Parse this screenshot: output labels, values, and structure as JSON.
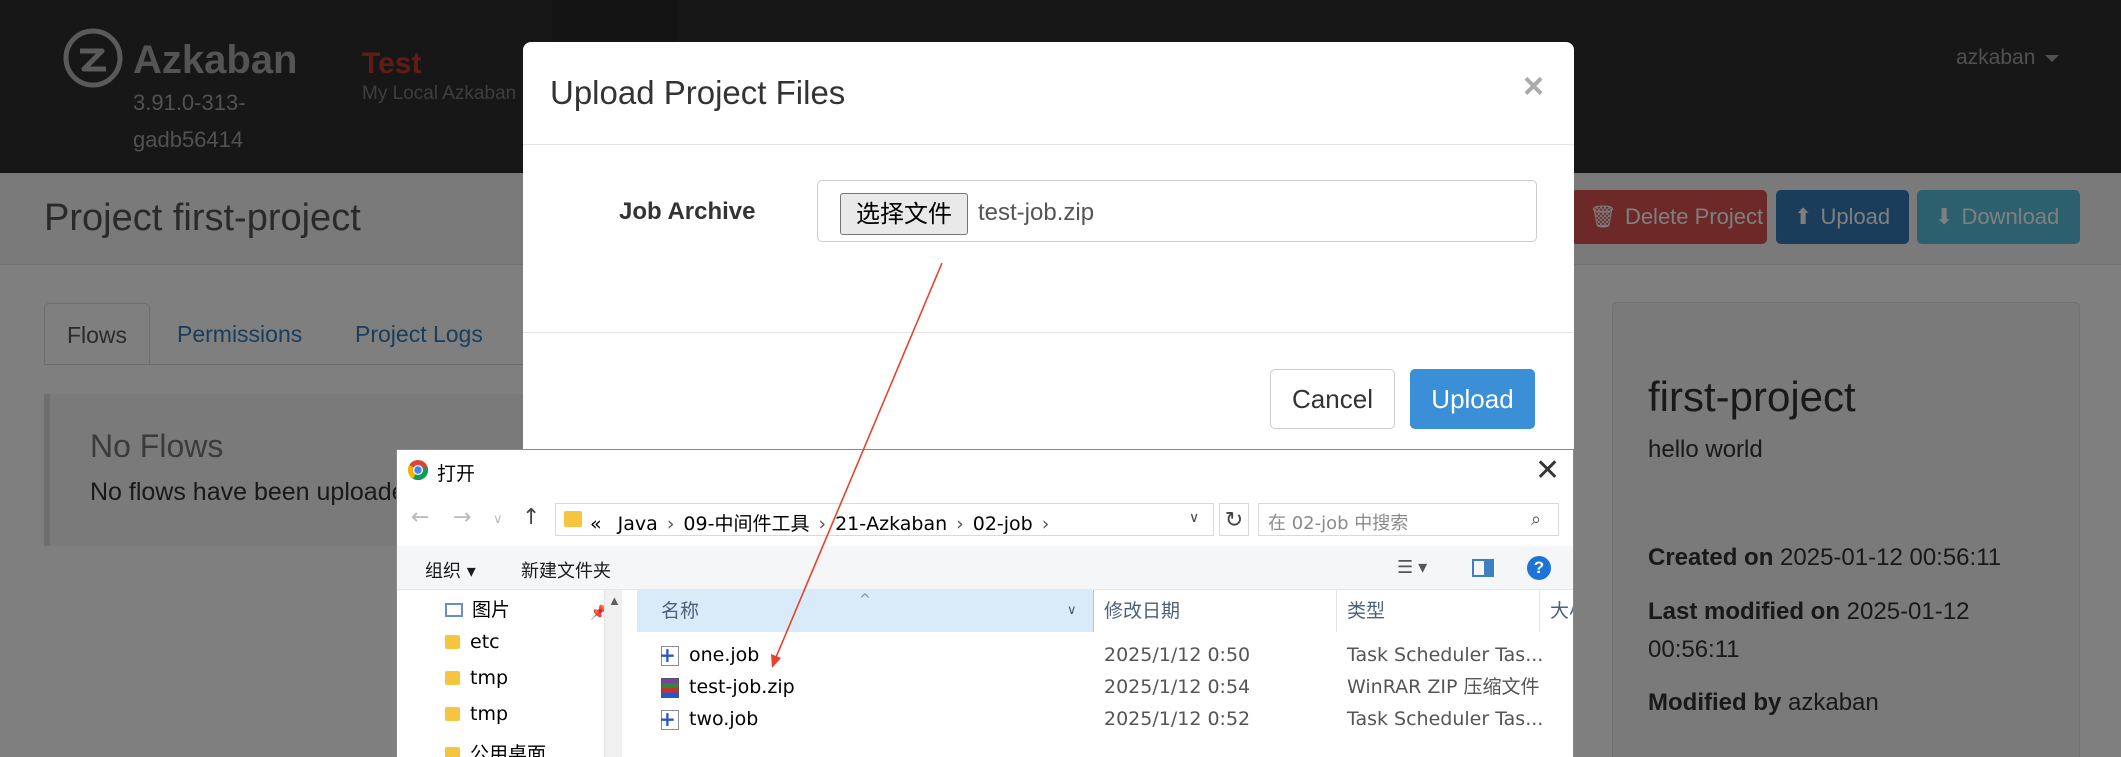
{
  "app": {
    "brand": "Azkaban",
    "version": "3.91.0-313-gadb56414",
    "env_name": "Test",
    "env_subtitle": "My Local Azkaban",
    "user": "azkaban"
  },
  "project": {
    "title": "Project first-project",
    "actions": {
      "delete_label": "Delete Project",
      "upload_label": "Upload",
      "download_label": "Download"
    },
    "tabs": [
      {
        "label": "Flows",
        "active": true
      },
      {
        "label": "Permissions",
        "active": false
      },
      {
        "label": "Project Logs",
        "active": false
      }
    ],
    "no_flows": {
      "title": "No Flows",
      "text": "No flows have been uploaded"
    },
    "info": {
      "name": "first-project",
      "description": "hello world",
      "created_label": "Created on",
      "created_value": "2025-01-12 00:56:11",
      "modified_label": "Last modified on",
      "modified_value": "2025-01-12 00:56:11",
      "modified_by_label": "Modified by",
      "modified_by_value": "azkaban"
    }
  },
  "modal": {
    "title": "Upload Project Files",
    "close_glyph": "×",
    "field_label": "Job Archive",
    "choose_file_label": "选择文件",
    "chosen_file": "test-job.zip",
    "cancel_label": "Cancel",
    "upload_label": "Upload"
  },
  "file_dialog": {
    "title": "打开",
    "close_glyph": "✕",
    "breadcrumb_prefix": "«",
    "breadcrumb": [
      "Java",
      "09-中间件工具",
      "21-Azkaban",
      "02-job"
    ],
    "search_placeholder": "在 02-job 中搜索",
    "toolbar": {
      "organize_label": "组织 ▾",
      "new_folder_label": "新建文件夹",
      "help_glyph": "?"
    },
    "nav_items": [
      {
        "label": "图片",
        "icon": "pictures-icon",
        "pinned": true
      },
      {
        "label": "etc",
        "icon": "folder-icon"
      },
      {
        "label": "tmp",
        "icon": "folder-icon"
      },
      {
        "label": "tmp",
        "icon": "folder-icon"
      },
      {
        "label": "公用桌面",
        "icon": "folder-icon"
      }
    ],
    "columns": {
      "name": "名称",
      "date": "修改日期",
      "type": "类型",
      "size": "大小"
    },
    "files": [
      {
        "name": "one.job",
        "date": "2025/1/12 0:50",
        "type": "Task Scheduler Tas...",
        "icon": "job-file-icon"
      },
      {
        "name": "test-job.zip",
        "date": "2025/1/12 0:54",
        "type": "WinRAR ZIP 压缩文件",
        "icon": "zip-file-icon"
      },
      {
        "name": "two.job",
        "date": "2025/1/12 0:52",
        "type": "Task Scheduler Tas...",
        "icon": "job-file-icon"
      }
    ]
  },
  "colors": {
    "navbar": "#2e2e2e",
    "env_name": "#c0392b",
    "danger": "#d9534f",
    "primary": "#337ab7",
    "info": "#5bc0de",
    "annotation_arrow": "#e8412c"
  }
}
